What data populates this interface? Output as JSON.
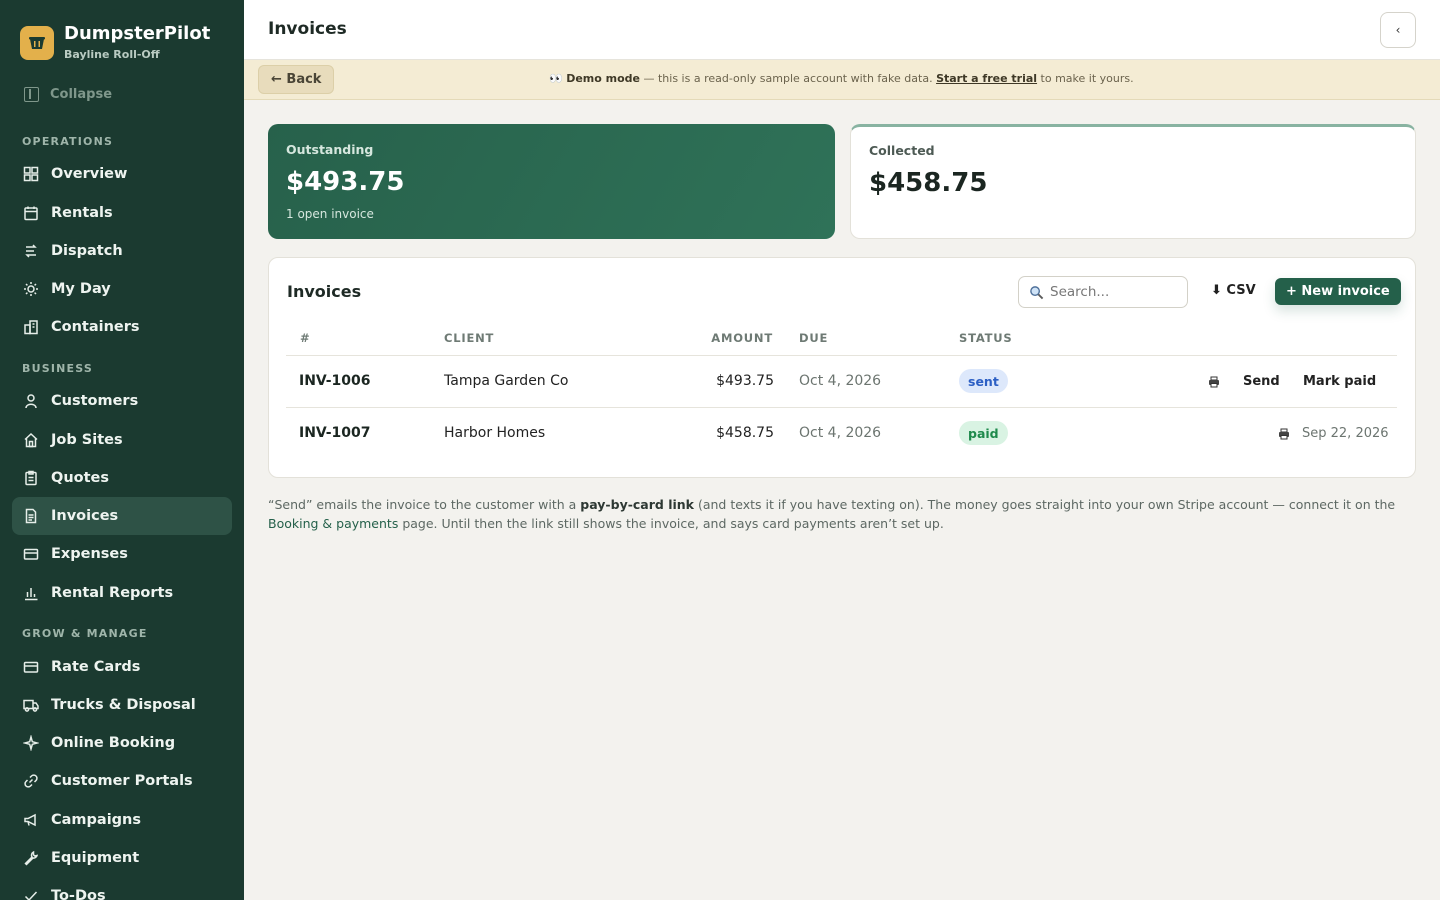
{
  "brand": {
    "name": "DumpsterPilot",
    "subtitle": "Bayline Roll-Off"
  },
  "sidebar": {
    "collapse_label": "Collapse",
    "sections": {
      "operations": "OPERATIONS",
      "business": "BUSINESS",
      "grow": "GROW & MANAGE"
    },
    "items": [
      {
        "label": "Overview",
        "icon": "grid-icon"
      },
      {
        "label": "Rentals",
        "icon": "calendar-icon"
      },
      {
        "label": "Dispatch",
        "icon": "route-icon"
      },
      {
        "label": "My Day",
        "icon": "sun-icon"
      },
      {
        "label": "Containers",
        "icon": "container-icon"
      },
      {
        "label": "Customers",
        "icon": "user-icon"
      },
      {
        "label": "Job Sites",
        "icon": "home-icon"
      },
      {
        "label": "Quotes",
        "icon": "clipboard-icon"
      },
      {
        "label": "Invoices",
        "icon": "document-icon",
        "active": true
      },
      {
        "label": "Expenses",
        "icon": "card-icon"
      },
      {
        "label": "Rental Reports",
        "icon": "bar-chart-icon"
      },
      {
        "label": "Rate Cards",
        "icon": "card-icon"
      },
      {
        "label": "Trucks & Disposal",
        "icon": "truck-icon"
      },
      {
        "label": "Online Booking",
        "icon": "sparkle-icon"
      },
      {
        "label": "Customer Portals",
        "icon": "link-icon"
      },
      {
        "label": "Campaigns",
        "icon": "megaphone-icon"
      },
      {
        "label": "Equipment",
        "icon": "wrench-icon"
      },
      {
        "label": "To-Dos",
        "icon": "check-icon"
      }
    ]
  },
  "header": {
    "title": "Invoices",
    "toggle_glyph": "‹"
  },
  "demo": {
    "back_label": "← Back",
    "emoji": "👀",
    "mode_label": "Demo mode",
    "message": " — this is a read-only sample account with fake data. ",
    "trial_link": "Start a free trial",
    "suffix": " to make it yours."
  },
  "summary": {
    "outstanding": {
      "label": "Outstanding",
      "value": "$493.75",
      "sub": "1 open invoice"
    },
    "collected": {
      "label": "Collected",
      "value": "$458.75"
    }
  },
  "invoices": {
    "title": "Invoices",
    "search_placeholder": "Search...",
    "csv_label": "⬇ CSV",
    "new_label": "+ New invoice",
    "columns": [
      "#",
      "CLIENT",
      "AMOUNT",
      "DUE",
      "STATUS"
    ],
    "rows": [
      {
        "id": "INV-1006",
        "client": "Tampa Garden Co",
        "amount": "$493.75",
        "due": "Oct 4, 2026",
        "status": "sent",
        "send": "Send",
        "mark_paid": "Mark paid"
      },
      {
        "id": "INV-1007",
        "client": "Harbor Homes",
        "amount": "$458.75",
        "due": "Oct 4, 2026",
        "status": "paid",
        "paid_date": "Sep 22, 2026"
      }
    ]
  },
  "footnote": {
    "p1": "“Send” emails the invoice to the customer with a ",
    "b1": "pay-by-card link",
    "p2": " (and texts it if you have texting on). The money goes straight into your own Stripe account — connect it on the ",
    "link": "Booking & payments",
    "p3": " page. Until then the link still shows the invoice, and says card payments aren’t set up."
  },
  "colors": {
    "sidebar_bg": "#1b3a30",
    "accent": "#24604a",
    "demo_bg": "#f4ecd4",
    "logo": "#e3b04b"
  }
}
